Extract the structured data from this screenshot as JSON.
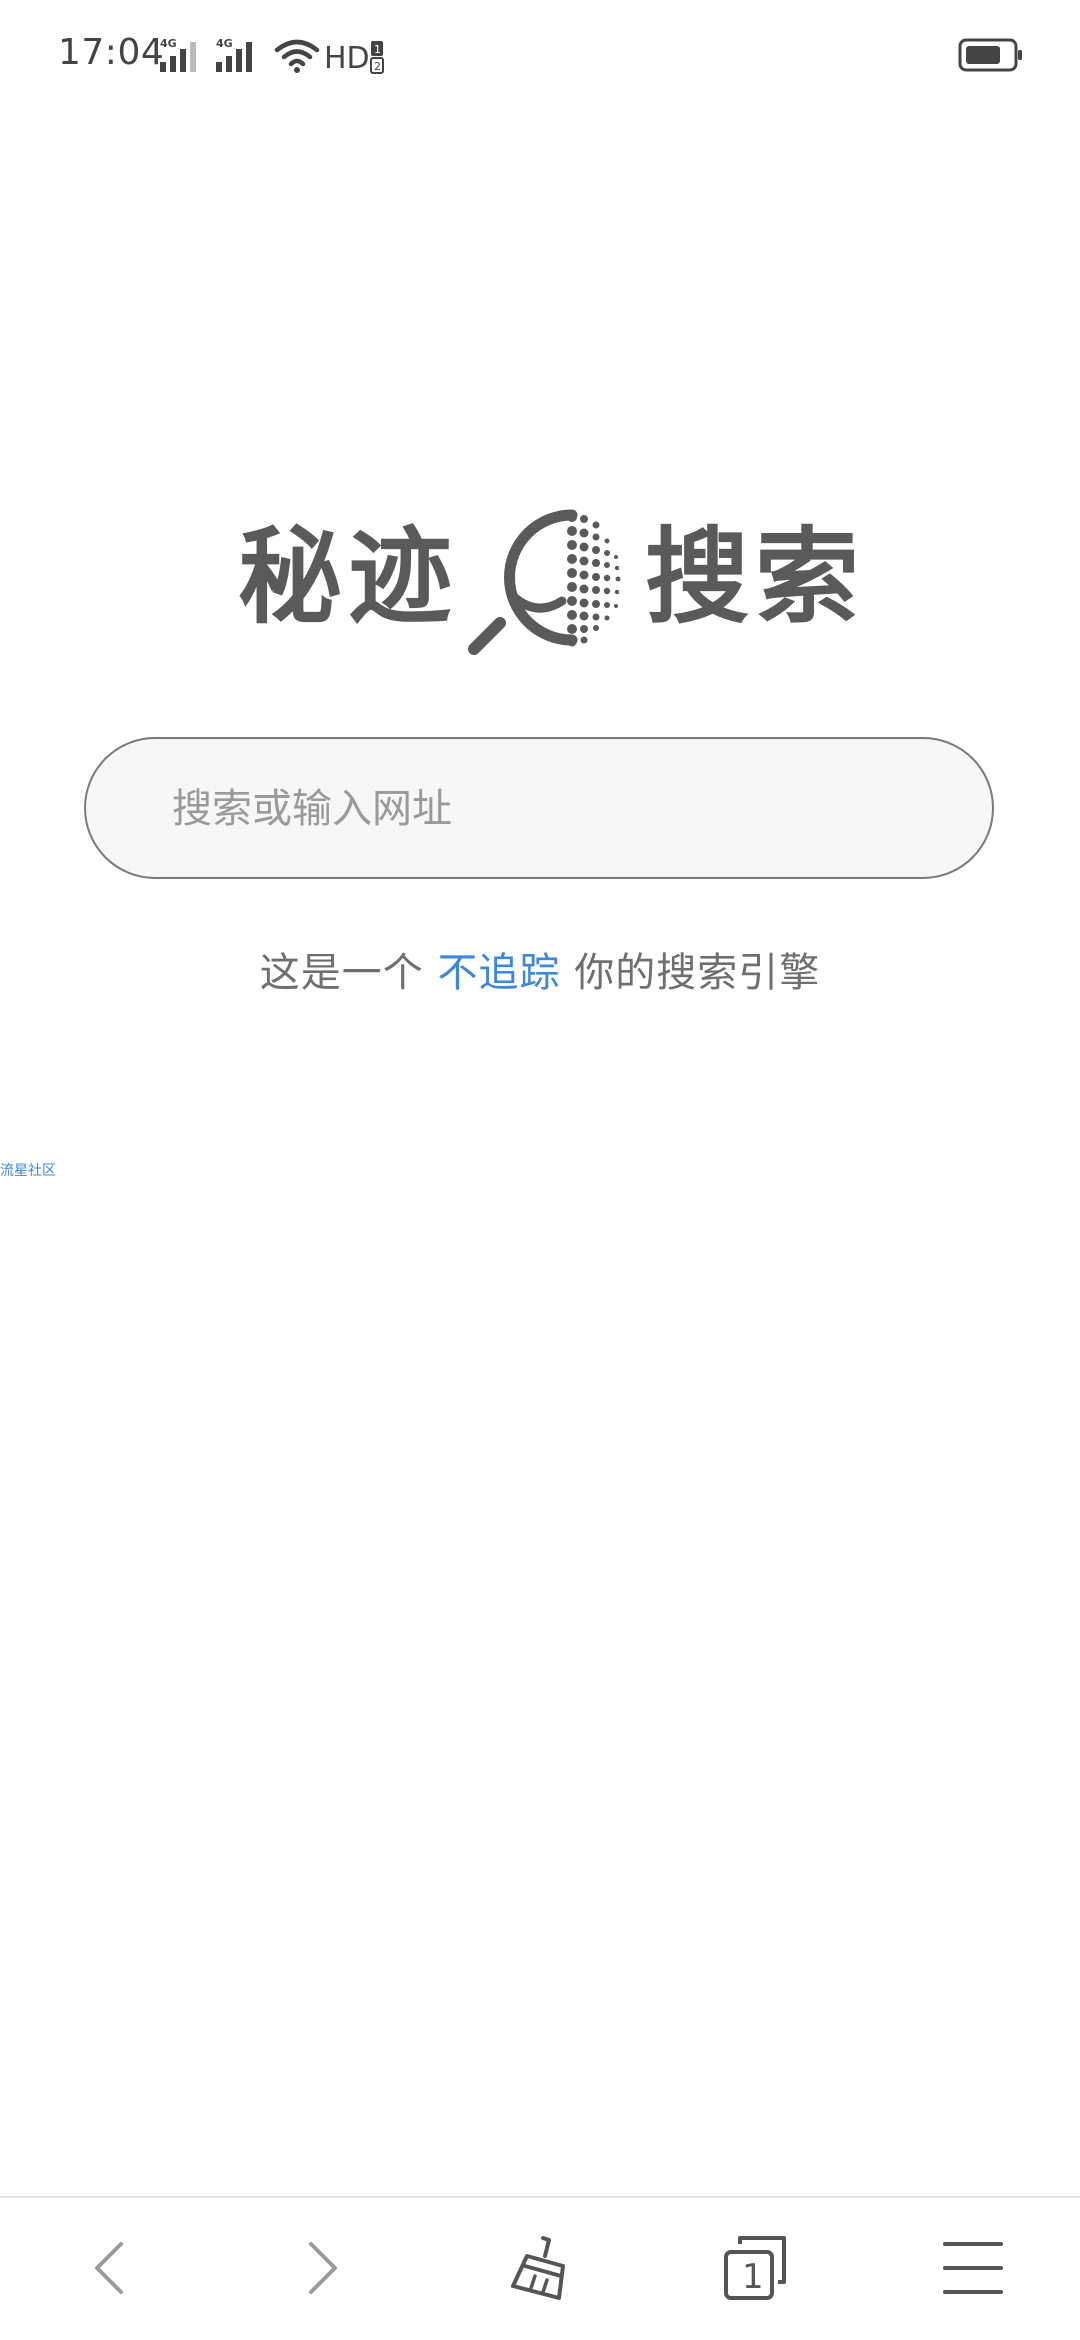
{
  "status_bar": {
    "time": "17:04",
    "network_1": "4G",
    "network_2": "4G",
    "hd": "HD",
    "hd_sub_1": "1",
    "hd_sub_2": "2"
  },
  "logo": {
    "left_text": "秘迹",
    "right_text": "搜索"
  },
  "search": {
    "placeholder": "搜索或输入网址",
    "value": ""
  },
  "tagline": {
    "prefix": "这是一个",
    "highlight": "不追踪",
    "suffix": "你的搜索引擎"
  },
  "community_link": "流星社区",
  "toolbar": {
    "tab_count": "1"
  },
  "colors": {
    "accent": "#3f87d9",
    "logo": "#5a5a5a",
    "text": "#6f6f6f",
    "placeholder": "#9a9a9a",
    "search_bg": "#f7f7f7",
    "search_border": "#7a7a7a"
  },
  "icons": {
    "back": "chevron-left-icon",
    "forward": "chevron-right-icon",
    "clean": "broom-icon",
    "tabs": "tabs-icon",
    "menu": "menu-icon",
    "wifi": "wifi-icon",
    "battery": "battery-icon",
    "signal": "signal-icon"
  }
}
